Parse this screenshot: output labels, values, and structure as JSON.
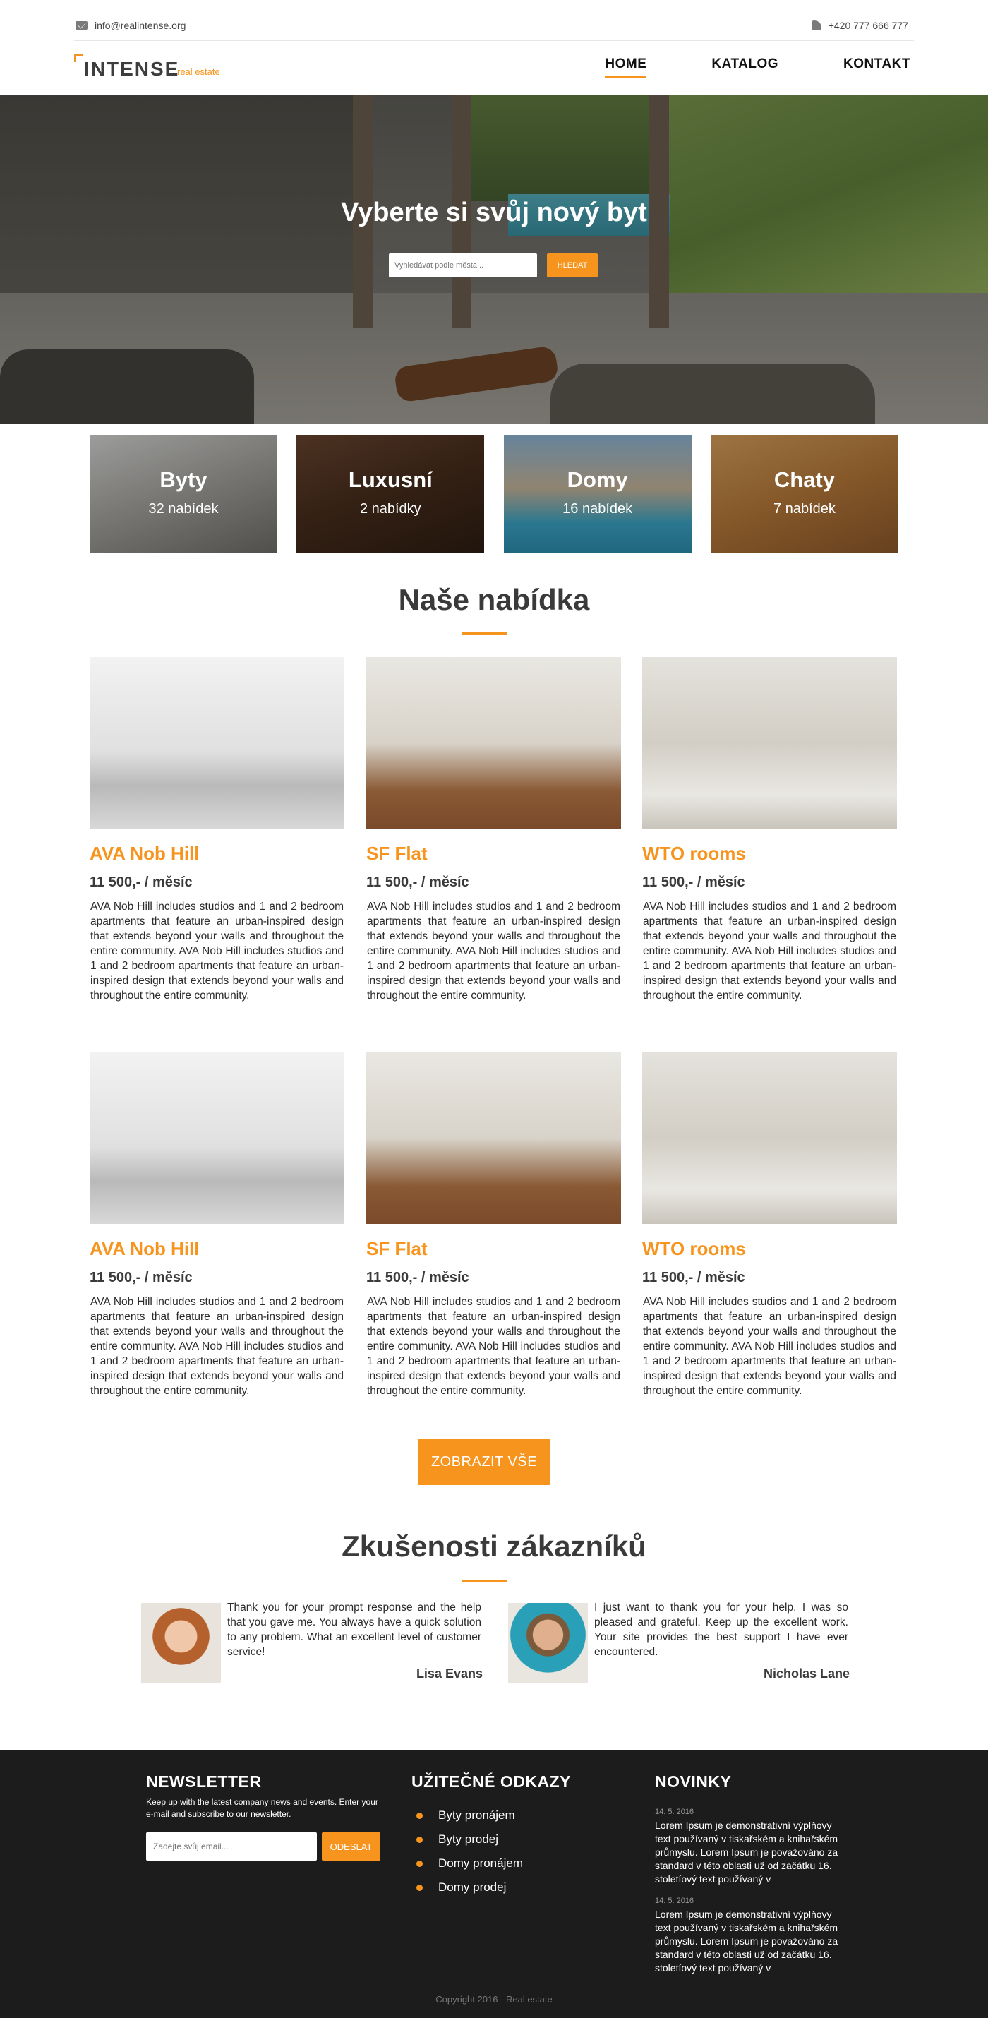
{
  "topbar": {
    "email": "info@realintense.org",
    "phone": "+420 777 666 777",
    "email_icon": "mail-icon",
    "phone_icon": "phone-icon"
  },
  "header": {
    "logo_word": "INTENSE",
    "logo_sub": "real estate",
    "nav": [
      {
        "label": "HOME",
        "active": true
      },
      {
        "label": "KATALOG",
        "active": false
      },
      {
        "label": "KONTAKT",
        "active": false
      }
    ]
  },
  "hero": {
    "title": "Vyberte si svůj nový byt",
    "search_placeholder": "Vyhledávat podle města...",
    "search_button": "HLEDAT"
  },
  "categories": [
    {
      "title": "Byty",
      "count": "32 nabídek"
    },
    {
      "title": "Luxusní",
      "count": "2 nabídky"
    },
    {
      "title": "Domy",
      "count": "16 nabídek"
    },
    {
      "title": "Chaty",
      "count": "7 nabídek"
    }
  ],
  "offers": {
    "title": "Naše nabídka",
    "items": [
      {
        "name": "AVA Nob Hill",
        "price": "11 500,- / měsíc",
        "desc": "AVA Nob Hill includes studios and 1 and 2 bedroom apartments that feature an urban-inspired design that extends beyond your walls and throughout the entire community. AVA Nob Hill includes studios and 1 and 2 bedroom apartments that feature an urban-inspired design that extends beyond your walls and throughout the entire community."
      },
      {
        "name": "SF Flat",
        "price": "11 500,- / měsíc",
        "desc": "AVA Nob Hill includes studios and 1 and 2 bedroom apartments that feature an urban-inspired design that extends beyond your walls and throughout the entire community. AVA Nob Hill includes studios and 1 and 2 bedroom apartments that feature an urban-inspired design that extends beyond your walls and throughout the entire community."
      },
      {
        "name": "WTO rooms",
        "price": "11 500,- / měsíc",
        "desc": "AVA Nob Hill includes studios and 1 and 2 bedroom apartments that feature an urban-inspired design that extends beyond your walls and throughout the entire community. AVA Nob Hill includes studios and 1 and 2 bedroom apartments that feature an urban-inspired design that extends beyond your walls and throughout the entire community."
      },
      {
        "name": "AVA Nob Hill",
        "price": "11 500,- / měsíc",
        "desc": "AVA Nob Hill includes studios and 1 and 2 bedroom apartments that feature an urban-inspired design that extends beyond your walls and throughout the entire community. AVA Nob Hill includes studios and 1 and 2 bedroom apartments that feature an urban-inspired design that extends beyond your walls and throughout the entire community."
      },
      {
        "name": "SF Flat",
        "price": "11 500,- / měsíc",
        "desc": "AVA Nob Hill includes studios and 1 and 2 bedroom apartments that feature an urban-inspired design that extends beyond your walls and throughout the entire community. AVA Nob Hill includes studios and 1 and 2 bedroom apartments that feature an urban-inspired design that extends beyond your walls and throughout the entire community."
      },
      {
        "name": "WTO rooms",
        "price": "11 500,- / měsíc",
        "desc": "AVA Nob Hill includes studios and 1 and 2 bedroom apartments that feature an urban-inspired design that extends beyond your walls and throughout the entire community. AVA Nob Hill includes studios and 1 and 2 bedroom apartments that feature an urban-inspired design that extends beyond your walls and throughout the entire community."
      }
    ],
    "show_all": "ZOBRAZIT VŠE"
  },
  "testimonials": {
    "title": "Zkušenosti zákazníků",
    "items": [
      {
        "text": "Thank you for your prompt response and the help that you gave me. You always have a quick solution to any problem. What an excellent level of customer service!",
        "name": "Lisa Evans"
      },
      {
        "text": "I just want to thank you for your help. I was so pleased and grateful. Keep up the excellent work. Your site provides the best support I have ever encountered.",
        "name": "Nicholas Lane"
      }
    ]
  },
  "footer": {
    "newsletter": {
      "title": "NEWSLETTER",
      "text": "Keep up with the latest company news and events. Enter your e-mail and subscribe to our newsletter.",
      "placeholder": "Zadejte svůj email...",
      "button": "ODESLAT"
    },
    "links": {
      "title": "UŽITEČNÉ ODKAZY",
      "items": [
        "Byty pronájem",
        "Byty prodej",
        "Domy pronájem",
        "Domy prodej"
      ]
    },
    "news": {
      "title": "NOVINKY",
      "items": [
        {
          "date": "14. 5. 2016",
          "text": "Lorem Ipsum je demonstrativní výplňový text používaný v tiskařském a knihařském průmyslu. Lorem Ipsum je považováno za standard v této oblasti už od začátku 16. století­ový text používaný v"
        },
        {
          "date": "14. 5. 2016",
          "text": "Lorem Ipsum je demonstrativní výplňový text používaný v tiskařském a knihařském průmyslu. Lorem Ipsum je považováno za standard v této oblasti už od začátku 16. století­ový text používaný v"
        }
      ]
    },
    "copyright": "Copyright 2016 - Real estate"
  },
  "colors": {
    "accent": "#f7941d",
    "footer_bg": "#1c1c1c",
    "text": "#3a3a3a"
  }
}
